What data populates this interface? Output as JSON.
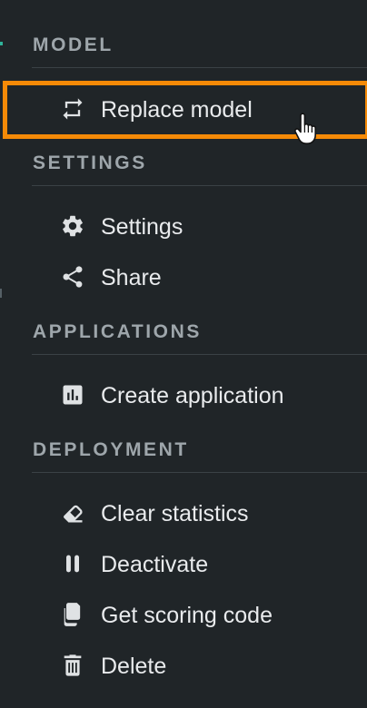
{
  "sections": [
    {
      "header": "MODEL",
      "items": [
        {
          "label": "Replace model",
          "icon": "replace-icon"
        }
      ]
    },
    {
      "header": "SETTINGS",
      "items": [
        {
          "label": "Settings",
          "icon": "gear-icon"
        },
        {
          "label": "Share",
          "icon": "share-icon"
        }
      ]
    },
    {
      "header": "APPLICATIONS",
      "items": [
        {
          "label": "Create application",
          "icon": "chart-icon"
        }
      ]
    },
    {
      "header": "DEPLOYMENT",
      "items": [
        {
          "label": "Clear statistics",
          "icon": "eraser-icon"
        },
        {
          "label": "Deactivate",
          "icon": "pause-icon"
        },
        {
          "label": "Get scoring code",
          "icon": "copy-icon"
        },
        {
          "label": "Delete",
          "icon": "trash-icon"
        }
      ]
    }
  ],
  "colors": {
    "background": "#202528",
    "highlight": "#f58a07",
    "section_header": "#9ea6ab",
    "label": "#e9ebed"
  }
}
